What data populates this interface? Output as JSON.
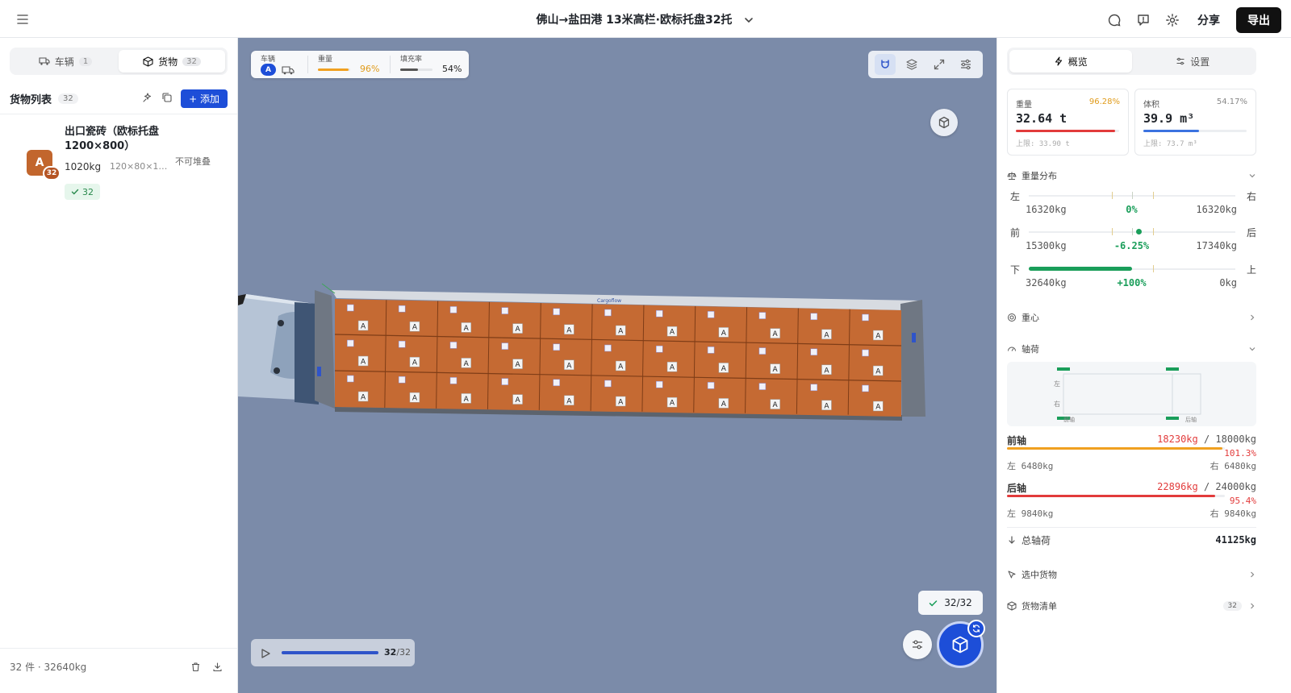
{
  "header": {
    "title": "佛山→盐田港 13米高栏·欧标托盘32托",
    "share_label": "分享",
    "export_label": "导出"
  },
  "left_panel": {
    "tabs": [
      {
        "label": "车辆",
        "count": "1"
      },
      {
        "label": "货物",
        "count": "32"
      }
    ],
    "list_title": "货物列表",
    "list_count": "32",
    "add_label": "+ 添加",
    "items": [
      {
        "avatar_letter": "A",
        "avatar_count": "32",
        "name": "出口瓷砖（欧标托盘1200×800）",
        "weight": "1020kg",
        "dims": "120×80×1…",
        "stack": "不可堆叠",
        "tag": "32"
      }
    ],
    "footer": "32 件 · 32640kg"
  },
  "viewport": {
    "stats": {
      "vehicle_label": "车辆",
      "vehicle_letter": "A",
      "weight_label": "重量",
      "weight_pct": "96%",
      "weight_fill": 0.96,
      "fill_label": "填充率",
      "fill_pct": "54%",
      "fill_fill": 0.54
    },
    "playback": {
      "current": "32",
      "total": "/32",
      "progress": 1.0
    },
    "done_badge": "32/32",
    "pallet_letter": "A",
    "truck_brand": "Cargoflow"
  },
  "right_panel": {
    "tabs": [
      {
        "label": "概览"
      },
      {
        "label": "设置"
      }
    ],
    "weight_card": {
      "label": "重量",
      "pct": "96.28%",
      "value": "32.64 t",
      "limit": "上限: 33.90 t",
      "fill": 0.9628,
      "color": "#e23b3b",
      "pct_color": "#e09b1a"
    },
    "volume_card": {
      "label": "体积",
      "pct": "54.17%",
      "value": "39.9 m³",
      "limit": "上限: 73.7 m³",
      "fill": 0.5417,
      "color": "#3b73e0",
      "pct_color": "#888888"
    },
    "distribution": {
      "title": "重量分布",
      "rows": [
        {
          "left": "左",
          "right": "右",
          "lv": "16320kg",
          "cv": "0%",
          "rv": "16320kg",
          "marker": 0.5
        },
        {
          "left": "前",
          "right": "后",
          "lv": "15300kg",
          "cv": "-6.25%",
          "rv": "17340kg",
          "marker": 0.53
        },
        {
          "left": "下",
          "right": "上",
          "lv": "32640kg",
          "cv": "+100%",
          "rv": "0kg",
          "fill": 0.5
        }
      ]
    },
    "center_of_gravity": "重心",
    "axle": {
      "title": "轴荷",
      "diagram": {
        "left": "左",
        "right": "右",
        "front": "前轴",
        "rear": "后轴"
      },
      "front": {
        "name": "前轴",
        "value": "18230kg",
        "limit": " / 18000kg",
        "pct": "101.3%",
        "left": "左 6480kg",
        "right": "右 6480kg",
        "fill": 0.99,
        "color": "#f0a020"
      },
      "rear": {
        "name": "后轴",
        "value": "22896kg",
        "limit": " / 24000kg",
        "pct": "95.4%",
        "left": "左 9840kg",
        "right": "右 9840kg",
        "fill": 0.954,
        "color": "#e23b3b"
      },
      "total_label": "总轴荷",
      "total_value": "41125kg"
    },
    "selected_cargo": "选中货物",
    "cargo_list": "货物清单",
    "cargo_list_count": "32"
  }
}
